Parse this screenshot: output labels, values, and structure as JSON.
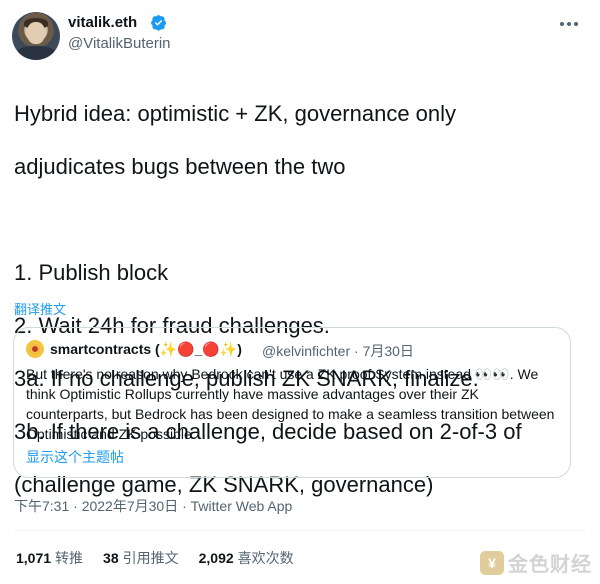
{
  "author": {
    "name": "vitalik.eth",
    "handle": "@VitalikButerin"
  },
  "tweet": {
    "lines": [
      "Hybrid idea: optimistic + ZK, governance only",
      "adjudicates bugs between the two",
      "",
      "1. Publish block",
      "2. Wait 24h for fraud challenges.",
      "3a. If no challenge, publish ZK SNARK, finalize.",
      "3b. If there is a challenge, decide based on 2-of-3 of",
      "(challenge game, ZK SNARK, governance)"
    ],
    "translate_label": "翻译推文"
  },
  "quote": {
    "name": "smartcontracts (✨🔴_🔴✨)",
    "meta": "@kelvinfichter · 7月30日",
    "text": "But there's no reason why Bedrock can't use a ZK proof System instead 👀👀. We think Optimistic Rollups currently have massive advantages over their ZK counterparts, but Bedrock has been designed to make a seamless transition between Optimistic and ZK possible.",
    "show_thread": "显示这个主题帖"
  },
  "footer": {
    "timestamp": "下午7:31 · 2022年7月30日 · Twitter Web App",
    "stats": [
      {
        "count": "1,071",
        "label": "转推"
      },
      {
        "count": "38",
        "label": "引用推文"
      },
      {
        "count": "2,092",
        "label": "喜欢次数"
      }
    ]
  },
  "watermark": {
    "logo": "¥",
    "text": "金色财经"
  },
  "colors": {
    "accent": "#1d9bf0",
    "secondary_text": "#536471",
    "primary_text": "#0f1419"
  },
  "icons": [
    "verified-badge-icon",
    "more-options-icon",
    "quote-author-avatar-icon"
  ]
}
